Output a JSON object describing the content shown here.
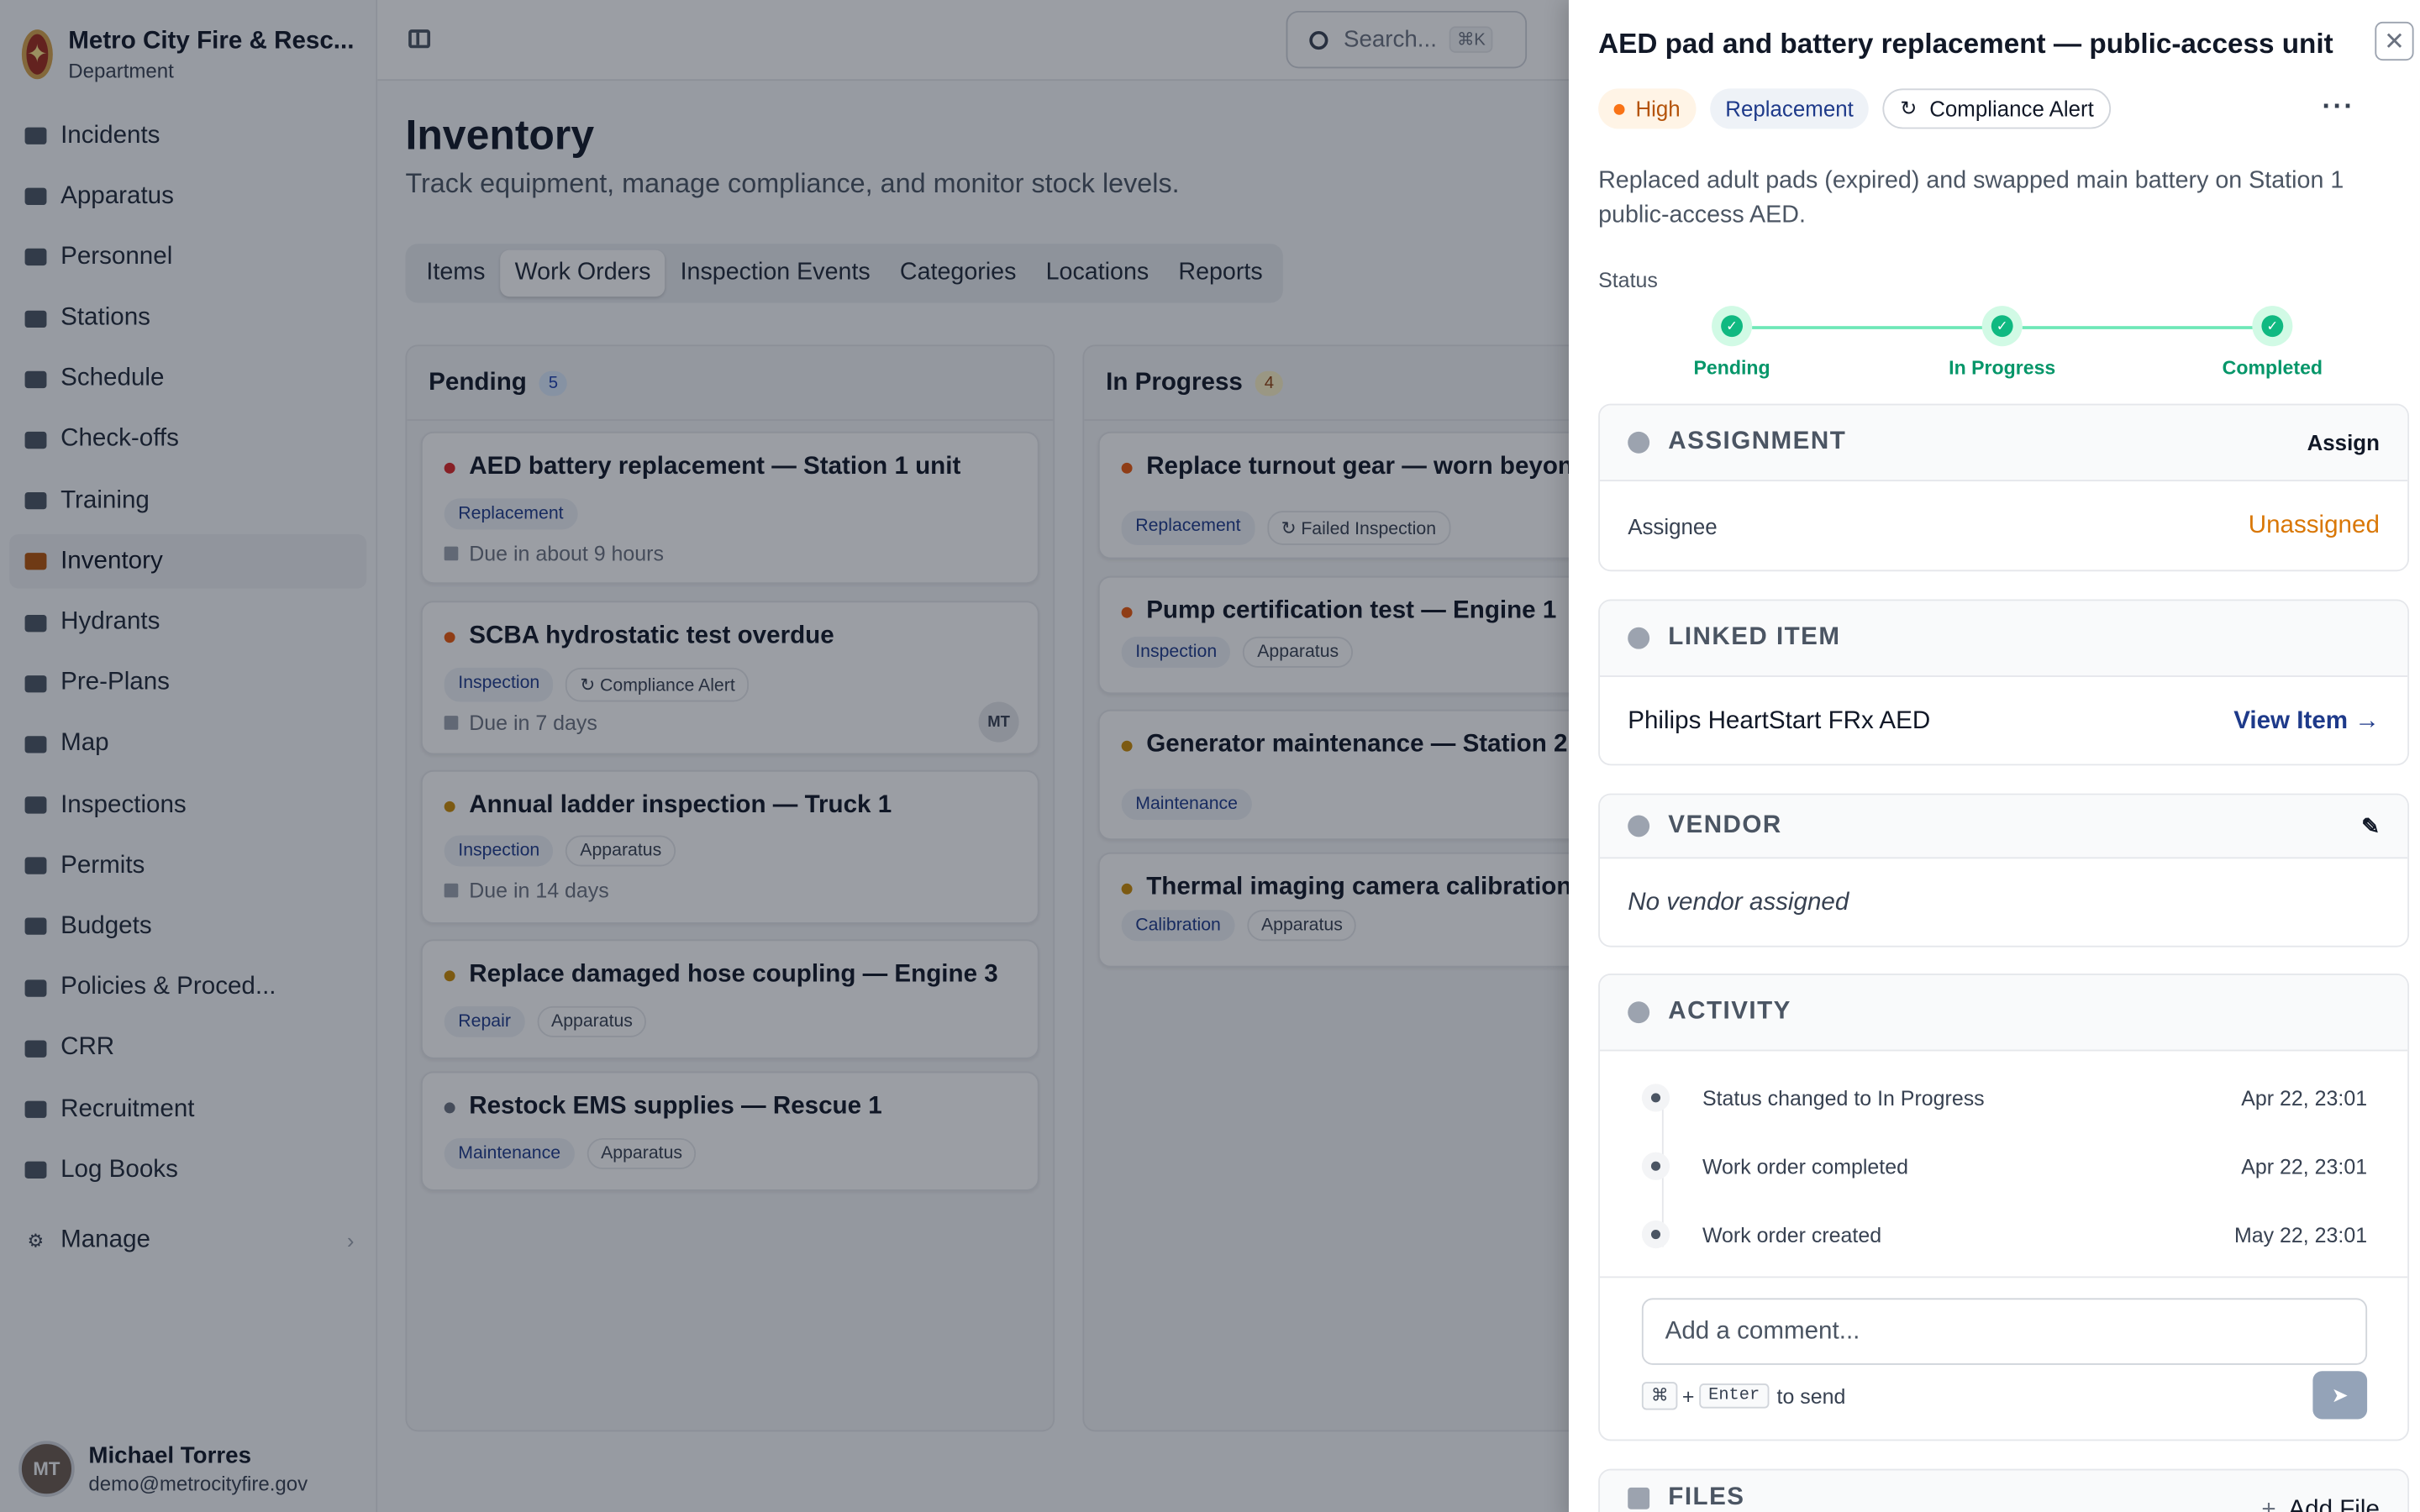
{
  "org": {
    "name": "Metro City Fire & Resc...",
    "sub": "Department"
  },
  "nav": [
    {
      "label": "Incidents",
      "icon": "incidents-icon",
      "active": false
    },
    {
      "label": "Apparatus",
      "icon": "apparatus-icon",
      "active": false
    },
    {
      "label": "Personnel",
      "icon": "personnel-icon",
      "active": false
    },
    {
      "label": "Stations",
      "icon": "stations-icon",
      "active": false
    },
    {
      "label": "Schedule",
      "icon": "calendar-icon",
      "active": false
    },
    {
      "label": "Check-offs",
      "icon": "checklist-icon",
      "active": false
    },
    {
      "label": "Training",
      "icon": "graduation-cap-icon",
      "active": false
    },
    {
      "label": "Inventory",
      "icon": "hammer-icon",
      "active": true
    },
    {
      "label": "Hydrants",
      "icon": "hydrant-icon",
      "active": false
    },
    {
      "label": "Pre-Plans",
      "icon": "building-search-icon",
      "active": false
    },
    {
      "label": "Map",
      "icon": "map-icon",
      "active": false
    },
    {
      "label": "Inspections",
      "icon": "clipboard-icon",
      "active": false
    },
    {
      "label": "Permits",
      "icon": "permit-icon",
      "active": false
    },
    {
      "label": "Budgets",
      "icon": "money-bag-icon",
      "active": false
    },
    {
      "label": "Policies & Proced...",
      "icon": "book-icon",
      "active": false
    },
    {
      "label": "CRR",
      "icon": "megaphone-icon",
      "active": false
    },
    {
      "label": "Recruitment",
      "icon": "handshake-icon",
      "active": false
    },
    {
      "label": "Log Books",
      "icon": "books-icon",
      "active": false
    }
  ],
  "manage": {
    "label": "Manage"
  },
  "user": {
    "name": "Michael Torres",
    "email": "demo@metrocityfire.gov"
  },
  "search": {
    "placeholder": "Search...",
    "shortcut": "⌘K"
  },
  "page": {
    "title": "Inventory",
    "subtitle": "Track equipment, manage compliance, and monitor stock levels."
  },
  "tabs": [
    {
      "label": "Items",
      "active": false
    },
    {
      "label": "Work Orders",
      "active": true
    },
    {
      "label": "Inspection Events",
      "active": false
    },
    {
      "label": "Categories",
      "active": false
    },
    {
      "label": "Locations",
      "active": false
    },
    {
      "label": "Reports",
      "active": false
    }
  ],
  "columns": [
    {
      "title": "Pending",
      "count": "5",
      "cards": [
        {
          "title": "AED battery replacement — Station 1 unit",
          "priority_color": "#dc2626",
          "badges": [
            "Replacement"
          ],
          "due": "Due in about 9 hours",
          "assignee": ""
        },
        {
          "title": "SCBA hydrostatic test overdue",
          "priority_color": "#ea580c",
          "badges": [
            "Inspection",
            "Compliance Alert"
          ],
          "due": "Due in 7 days",
          "assignee": "MT"
        },
        {
          "title": "Annual ladder inspection — Truck 1",
          "priority_color": "#ca8a04",
          "badges": [
            "Inspection",
            "Apparatus"
          ],
          "due": "Due in 14 days",
          "assignee": ""
        },
        {
          "title": "Replace damaged hose coupling — Engine 3",
          "priority_color": "#ca8a04",
          "badges": [
            "Repair",
            "Apparatus"
          ],
          "due": "",
          "assignee": ""
        },
        {
          "title": "Restock EMS supplies — Rescue 1",
          "priority_color": "#6b7280",
          "badges": [
            "Maintenance",
            "Apparatus"
          ],
          "due": "",
          "assignee": ""
        }
      ]
    },
    {
      "title": "In Progress",
      "count": "4",
      "cards": [
        {
          "title": "Replace turnout gear — worn beyond s",
          "priority_color": "#ea580c",
          "badges": [
            "Replacement",
            "Failed Inspection"
          ],
          "due": "",
          "assignee": ""
        },
        {
          "title": "Pump certification test — Engine 1",
          "priority_color": "#ea580c",
          "badges": [
            "Inspection",
            "Apparatus"
          ],
          "due": "",
          "assignee": ""
        },
        {
          "title": "Generator maintenance — Station 2",
          "priority_color": "#ca8a04",
          "badges": [
            "Maintenance"
          ],
          "due": "",
          "assignee": ""
        },
        {
          "title": "Thermal imaging camera calibration",
          "priority_color": "#ca8a04",
          "badges": [
            "Calibration",
            "Apparatus"
          ],
          "due": "",
          "assignee": ""
        }
      ]
    }
  ],
  "panel": {
    "title": "AED pad and battery replacement — public-access unit",
    "priority": "High",
    "type": "Replacement",
    "source": "Compliance Alert",
    "description": "Replaced adult pads (expired) and swapped main battery on Station 1 public-access AED.",
    "status_label": "Status",
    "steps": [
      "Pending",
      "In Progress",
      "Completed"
    ],
    "assignment": {
      "heading": "ASSIGNMENT",
      "action": "Assign",
      "label": "Assignee",
      "value": "Unassigned"
    },
    "linked": {
      "heading": "LINKED ITEM",
      "item": "Philips HeartStart FRx AED",
      "action": "View Item →"
    },
    "vendor": {
      "heading": "VENDOR",
      "empty": "No vendor assigned"
    },
    "activity": {
      "heading": "ACTIVITY",
      "entries": [
        {
          "text": "Status changed to In Progress",
          "time": "Apr 22, 23:01"
        },
        {
          "text": "Work order completed",
          "time": "Apr 22, 23:01"
        },
        {
          "text": "Work order created",
          "time": "May 22, 23:01"
        }
      ],
      "comment_placeholder": "Add a comment...",
      "hint_key1": "⌘",
      "hint_plus": "+",
      "hint_key2": "Enter",
      "hint_text": "to send"
    },
    "files": {
      "heading": "FILES",
      "action": "Add File"
    }
  },
  "colors": {
    "accent": "#1e3a8a",
    "success": "#10b981",
    "warning": "#d97706",
    "high": "#f97316"
  }
}
